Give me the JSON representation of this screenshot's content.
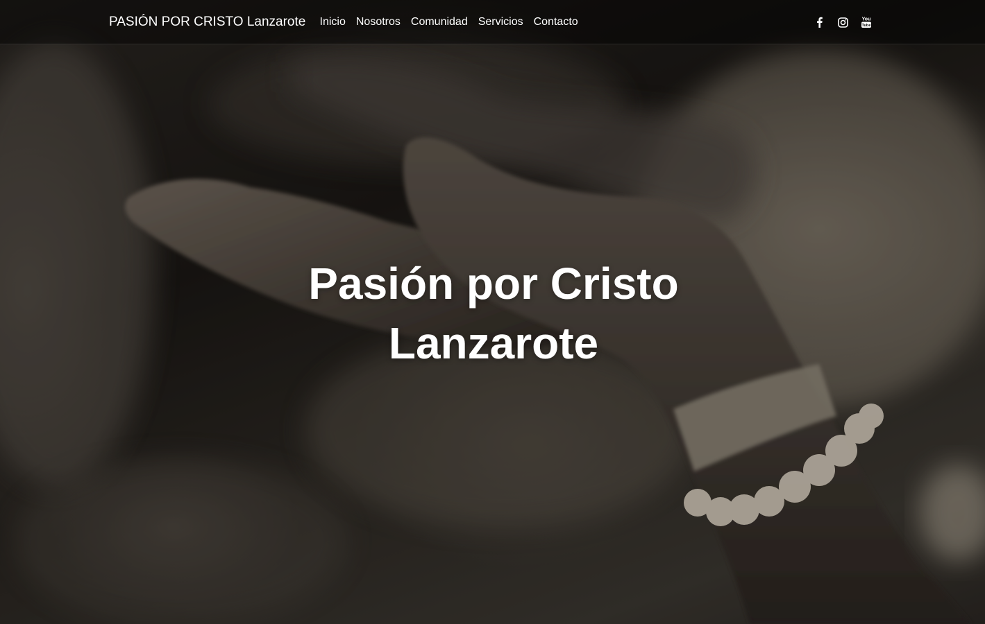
{
  "navbar": {
    "brand": "PASIÓN POR CRISTO Lanzarote",
    "links": [
      {
        "label": "Inicio"
      },
      {
        "label": "Nosotros"
      },
      {
        "label": "Comunidad"
      },
      {
        "label": "Servicios"
      },
      {
        "label": "Contacto"
      }
    ],
    "social": [
      {
        "icon": "facebook-icon"
      },
      {
        "icon": "instagram-icon"
      },
      {
        "icon": "youtube-icon",
        "label": "You Tube"
      }
    ]
  },
  "hero": {
    "title_line1": "Pasión por Cristo",
    "title_line2": "Lanzarote",
    "background": "sepia photograph of outstretched open hands with a pearl bracelet and a watch"
  },
  "colors": {
    "text": "#ffffff",
    "navbar_bg": "rgba(0,0,0,0.42)",
    "tone_dark": "#1a1714",
    "tone_light": "#b7ab9a"
  }
}
